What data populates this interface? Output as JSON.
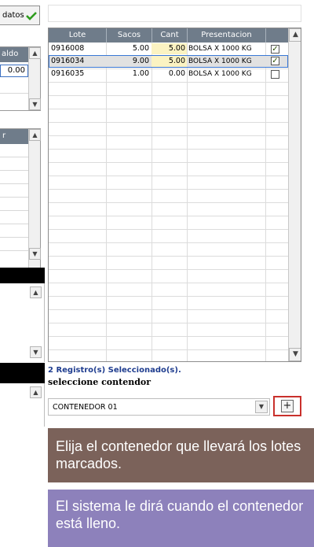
{
  "top_button": {
    "label": "datos",
    "icon": "check-icon"
  },
  "left_grid1": {
    "header": "aldo",
    "row_value": "0.00"
  },
  "left_grid2": {
    "header": "r"
  },
  "main_grid": {
    "columns": [
      "Lote",
      "Sacos",
      "Cant",
      "Presentacion"
    ],
    "rows": [
      {
        "lote": "0916008",
        "sacos": "5.00",
        "cant": "5.00",
        "presentacion": "BOLSA X 1000 KG",
        "checked": true
      },
      {
        "lote": "0916034",
        "sacos": "9.00",
        "cant": "5.00",
        "presentacion": "BOLSA X 1000 KG",
        "checked": true
      },
      {
        "lote": "0916035",
        "sacos": "1.00",
        "cant": "0.00",
        "presentacion": "BOLSA X 1000 KG",
        "checked": false
      }
    ]
  },
  "status": {
    "selected_count": "2 Registro(s) Seleccionado(s).",
    "prompt": "seleccione contendor"
  },
  "container_select": {
    "value": "CONTENEDOR 01"
  },
  "add_button": {
    "icon": "plus-icon"
  },
  "callouts": {
    "first": "Elija el contenedor que llevará los lotes marcados.",
    "second": "El sistema le dirá cuando el contenedor está lleno."
  }
}
